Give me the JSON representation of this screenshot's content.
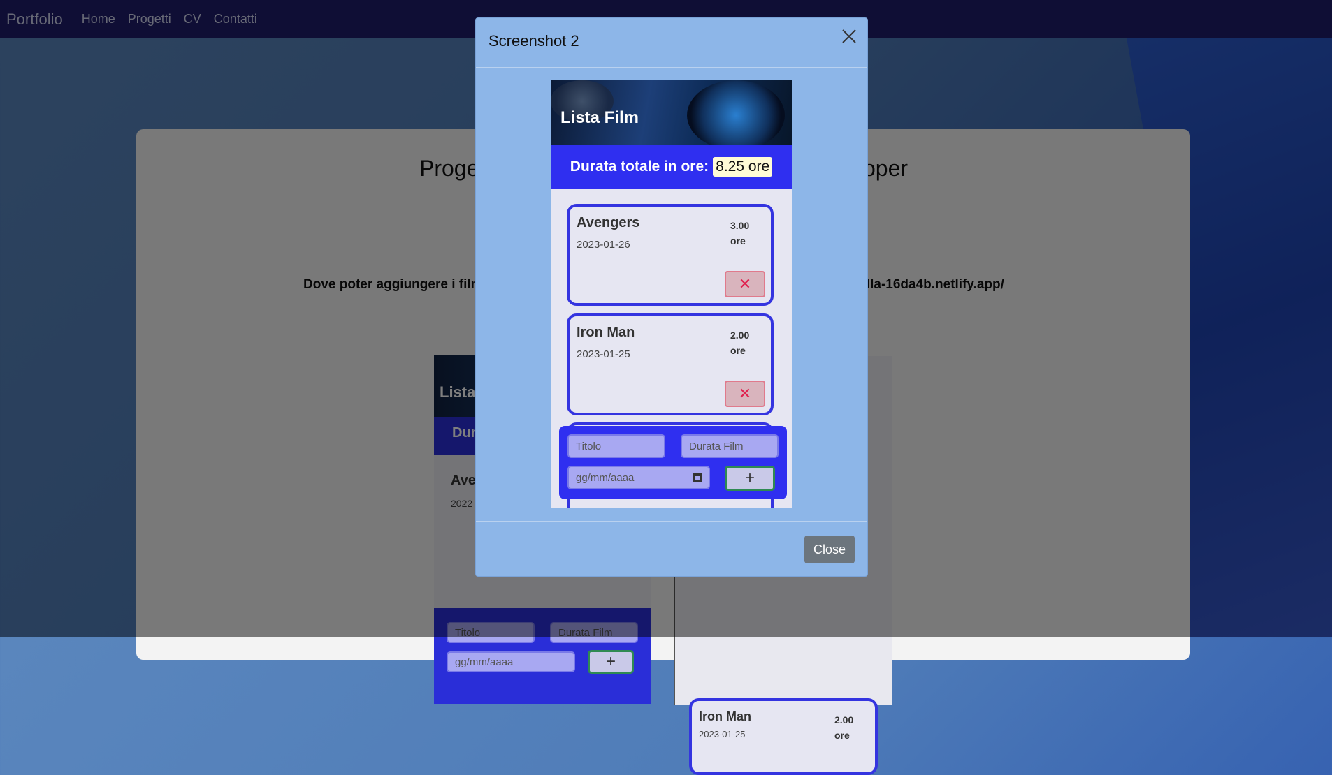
{
  "navbar": {
    "brand": "Portfolio",
    "links": [
      "Home",
      "Progetti",
      "CV",
      "Contatti"
    ]
  },
  "background_page": {
    "title_left": "Proge",
    "title_right": "oper",
    "description_left": "Dove poter aggiungere i film",
    "description_right": "figolla-16da4b.netlify.app/",
    "left_shot": {
      "title": "Avengers",
      "date": "2022",
      "form": {
        "titolo": "Titolo",
        "durata": "Durata Film",
        "date": "gg/mm/aaaa",
        "add": "+"
      },
      "banner": "Lista",
      "total": "Dur"
    },
    "right_shot": {
      "title": "Iron Man",
      "date": "2023-01-25",
      "duration_value": "2.00",
      "duration_unit": "ore"
    }
  },
  "modal": {
    "title": "Screenshot 2",
    "close_button": "Close",
    "screenshot": {
      "banner_title": "Lista Film",
      "total_label": "Durata totale in ore:",
      "total_value": "8.25 ore",
      "movies": [
        {
          "title": "Avengers",
          "date": "2023-01-26",
          "duration_value": "3.00",
          "duration_unit": "ore"
        },
        {
          "title": "Iron Man",
          "date": "2023-01-25",
          "duration_value": "2.00",
          "duration_unit": "ore"
        }
      ],
      "form": {
        "title_placeholder": "Titolo",
        "duration_placeholder": "Durata Film",
        "date_placeholder": "gg/mm/aaaa",
        "add_button": "+"
      },
      "delete_symbol": "✕"
    }
  },
  "colors": {
    "navbar": "#1f1d6b",
    "modal": "#8db6e8",
    "accent_blue": "#2f2ff0",
    "close_button": "#6c757d"
  }
}
